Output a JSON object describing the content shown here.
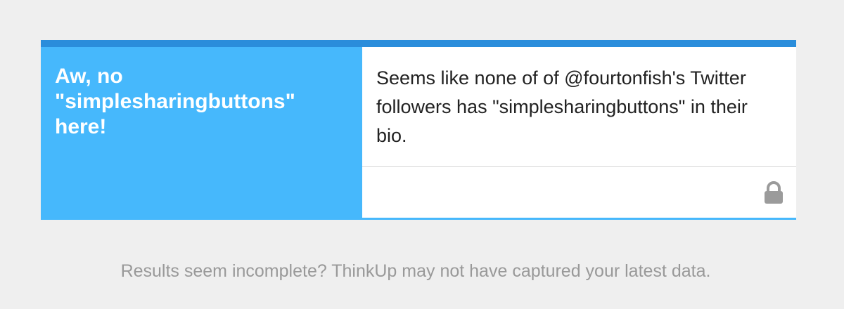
{
  "insight": {
    "headline": "Aw, no \"simplesharingbuttons\" here!",
    "body": "Seems like none of of @fourtonfish's Twitter followers has \"simplesharingbuttons\" in their bio.",
    "privacy_icon": "lock-icon"
  },
  "footer": {
    "note": "Results seem incomplete? ThinkUp may not have captured your latest data."
  },
  "colors": {
    "accent": "#2a8ddb",
    "headline_bg": "#46b8fc",
    "footer_text": "#999999"
  }
}
